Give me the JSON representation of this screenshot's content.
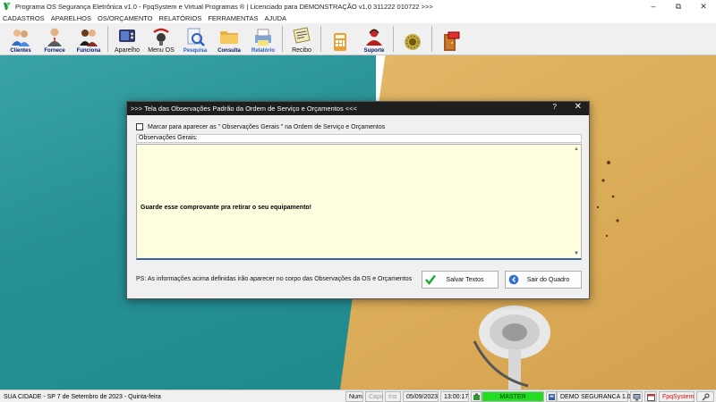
{
  "window": {
    "title": "Programa OS Segurança Eletrônica v1.0 - FpqSystem e Virtual Programas ® | Licenciado para  DEMONSTRAÇÃO v1.0 311222 010722 >>>",
    "controls": [
      "minimize",
      "maximize",
      "close"
    ]
  },
  "menu": [
    "CADASTROS",
    "APARELHOS",
    "OS/ORÇAMENTO",
    "RELATÓRIOS",
    "FERRAMENTAS",
    "AJUDA"
  ],
  "toolbar": {
    "clientes": "Clientes",
    "fornece": "Fornece",
    "funciona": "Funciona",
    "aparelho": "Aparelho",
    "menu_os": "Menu OS",
    "pesquisa": "Pesquisa",
    "consulta": "Consulta",
    "relatorio": "Relatório",
    "recibo": "Recibo",
    "suporte": "Suporte"
  },
  "dialog": {
    "title": ">>>  Tela das Observações Padrão da Ordem de Serviço e Orçamentos  <<<",
    "help": "?",
    "checkbox_label": "Marcar para aparecer as \" Observações Gerais \" na Ordem de Serviço e Orçamentos",
    "checkbox_checked": false,
    "obs_label": "Observações Gerais:",
    "memo_text": "Guarde esse comprovante pra retirar o seu equipamento!",
    "ps_note": "PS: As informações acima definidas irão aparecer no corpo das Observações da OS e Orçamentos",
    "save_button": "Salvar Textos",
    "exit_button": "Sair do Quadro"
  },
  "statusbar": {
    "city_date": "SUA CIDADE - SP  7 de Setembro de 2023 - Quinta-feira",
    "num": "Num",
    "caps": "Caps",
    "ins": "Ins",
    "date": "05/09/2023",
    "time": "13:00:17",
    "user": "MASTER",
    "company": "DEMO SEGURANCA 1.0",
    "brand": "FpqSystem",
    "colors": {
      "master_bg": "#22dd22",
      "brand": "#d41010"
    }
  }
}
